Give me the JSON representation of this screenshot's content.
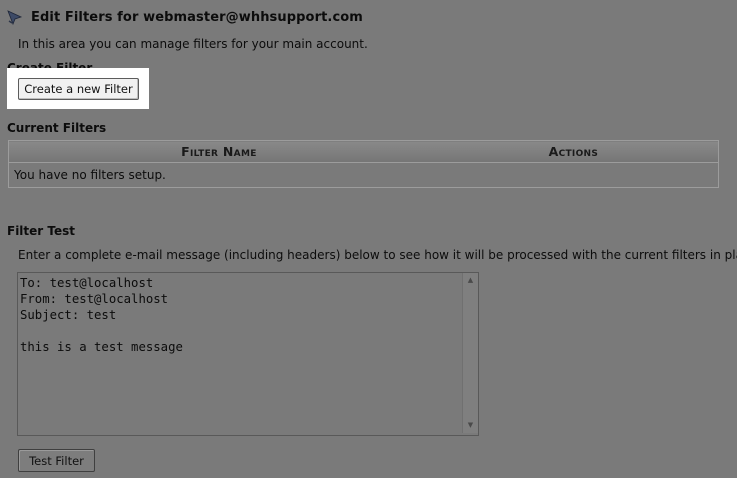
{
  "header": {
    "title": "Edit Filters for webmaster@whhsupport.com",
    "icon": "filter-icon"
  },
  "intro": "In this area you can manage filters for your main account.",
  "create_section": {
    "heading": "Create Filter",
    "button_label": "Create a new Filter"
  },
  "current_section": {
    "heading": "Current Filters",
    "columns": [
      "Filter Name",
      "Actions"
    ],
    "empty_message": "You have no filters setup."
  },
  "test_section": {
    "heading": "Filter Test",
    "description": "Enter a complete e-mail message (including headers) below to see how it will be processed with the current filters in place.",
    "message_value": "To: test@localhost\nFrom: test@localhost\nSubject: test\n\nthis is a test message",
    "button_label": "Test Filter"
  },
  "colors": {
    "background": "#7a7a7a",
    "highlight": "#ffffff",
    "table_header": "#808080"
  }
}
